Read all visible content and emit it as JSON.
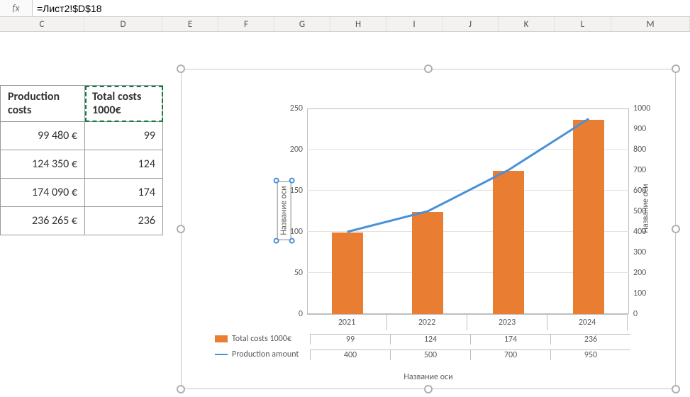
{
  "formula_bar": {
    "fx": "fx",
    "value": "=Лист2!$D$18"
  },
  "columns": [
    "C",
    "D",
    "E",
    "F",
    "G",
    "H",
    "I",
    "J",
    "K",
    "L",
    "M"
  ],
  "table": {
    "header_c": "Production costs",
    "header_d": "Total costs 1000€",
    "rows": [
      {
        "c": "99 480 €",
        "d": "99"
      },
      {
        "c": "124 350 €",
        "d": "124"
      },
      {
        "c": "174 090 €",
        "d": "174"
      },
      {
        "c": "236 265 €",
        "d": "236"
      }
    ]
  },
  "chart_data": {
    "type": "bar+line",
    "categories": [
      "2021",
      "2022",
      "2023",
      "2024"
    ],
    "series": [
      {
        "name": "Total costs 1000€",
        "kind": "bar",
        "axis": "left",
        "values": [
          99,
          124,
          174,
          236
        ],
        "color": "#e97e32"
      },
      {
        "name": "Production amount",
        "kind": "line",
        "axis": "right",
        "values": [
          400,
          500,
          700,
          950
        ],
        "color": "#4a90d9"
      }
    ],
    "y_left": {
      "min": 0,
      "max": 250,
      "step": 50,
      "title": "Название оси"
    },
    "y_right": {
      "min": 0,
      "max": 1000,
      "step": 100,
      "title": "Название оси"
    },
    "x_title": "Название оси"
  },
  "axis_titles": {
    "left": "Название оси",
    "right": "Название оси",
    "bottom": "Название оси"
  }
}
